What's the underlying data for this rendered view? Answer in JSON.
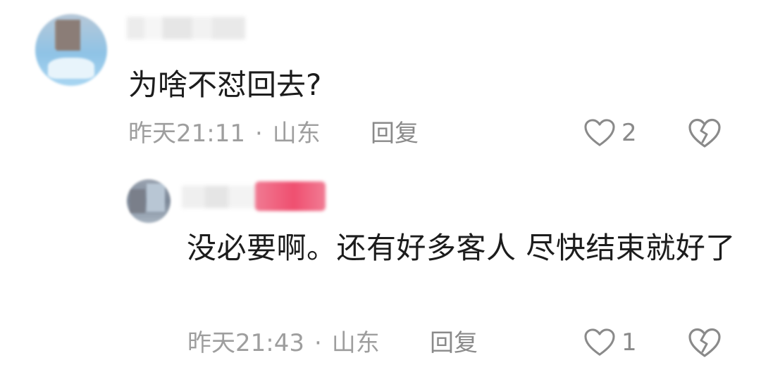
{
  "comments": [
    {
      "text": "为啥不怼回去?",
      "time": "昨天21:11",
      "separator": "·",
      "location": "山东",
      "reply_label": "回复",
      "likes": "2",
      "like_icon": "heart-outline-icon",
      "dislike_icon": "broken-heart-icon"
    },
    {
      "text": "没必要啊。还有好多客人  尽快结束就好了",
      "time": "昨天21:43",
      "separator": "·",
      "location": "山东",
      "reply_label": "回复",
      "likes": "1",
      "like_icon": "heart-outline-icon",
      "dislike_icon": "broken-heart-icon"
    }
  ],
  "colors": {
    "text": "#1c1c1c",
    "meta": "#9e9e9e",
    "badge": "#ef4f70"
  }
}
